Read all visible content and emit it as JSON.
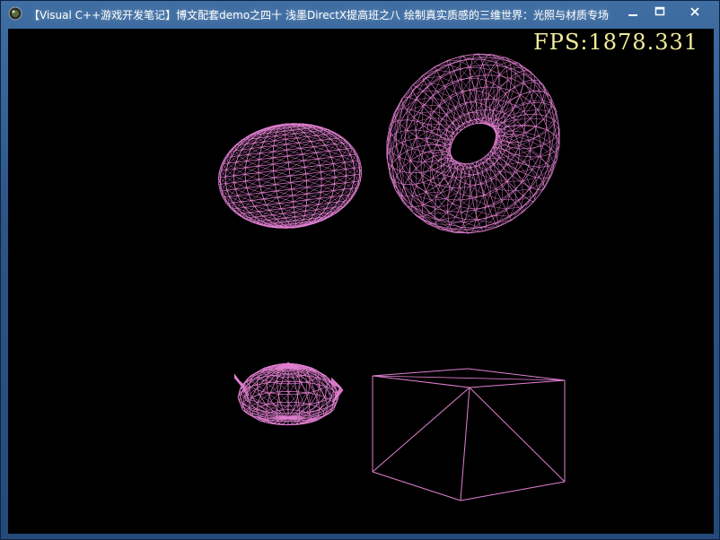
{
  "window": {
    "title": "【Visual C++游戏开发笔记】博文配套demo之四十 浅墨DirectX提高班之八 绘制真实质感的三维世界：光照与材质专场"
  },
  "hud": {
    "fps_text": "FPS:1878.331"
  },
  "scene": {
    "background": "#000000",
    "wire_color": "#e07fd0",
    "objects": [
      "sphere",
      "torus",
      "teapot",
      "box"
    ],
    "render_mode": "wireframe"
  },
  "caption_buttons": [
    "minimize-icon",
    "maximize-icon",
    "close-icon"
  ]
}
